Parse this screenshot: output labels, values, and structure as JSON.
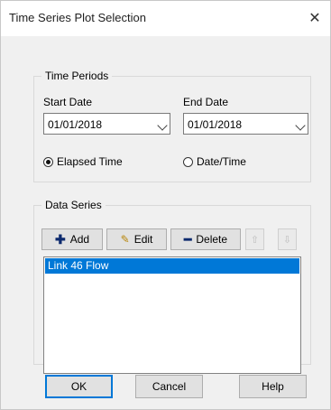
{
  "window": {
    "title": "Time Series Plot Selection"
  },
  "time_periods": {
    "legend": "Time Periods",
    "start_label": "Start Date",
    "end_label": "End Date",
    "start_value": "01/01/2018",
    "end_value": "01/01/2018",
    "radio_elapsed": "Elapsed Time",
    "radio_datetime": "Date/Time",
    "selected_radio": "Elapsed Time"
  },
  "data_series": {
    "legend": "Data Series",
    "add_label": "Add",
    "edit_label": "Edit",
    "delete_label": "Delete",
    "items": [
      "Link 46 Flow"
    ]
  },
  "buttons": {
    "ok": "OK",
    "cancel": "Cancel",
    "help": "Help"
  },
  "icons": {
    "add": "plus-icon",
    "edit": "edit-icon",
    "delete": "minus-icon",
    "up": "arrow-up-icon",
    "down": "arrow-down-icon",
    "close": "close-icon"
  },
  "colors": {
    "selection": "#0078d7",
    "default_button_border": "#0078d7",
    "dialog_bg": "#f0f0f0"
  }
}
